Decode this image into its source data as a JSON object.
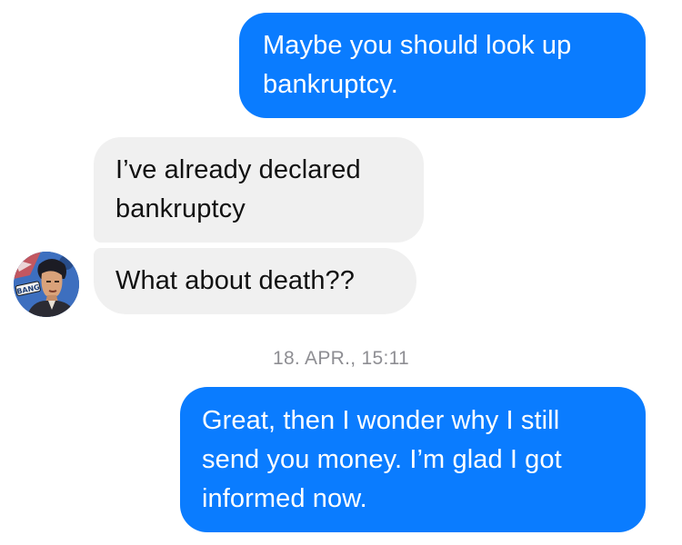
{
  "conversation": {
    "messages": [
      {
        "direction": "outgoing",
        "text": "Maybe you should look up bankruptcy."
      },
      {
        "direction": "incoming",
        "text": "I’ve already declared bankruptcy"
      },
      {
        "direction": "incoming",
        "text": "What about death??"
      },
      {
        "direction": "outgoing",
        "text": "Great, then I wonder why I still send you money. I’m glad I got informed now."
      }
    ],
    "timestamp": "18. APR., 15:11"
  },
  "contact": {
    "avatar_icon": "comic-portrait-avatar",
    "avatar_text": "BANG"
  },
  "colors": {
    "outgoing_bubble": "#0a7cff",
    "incoming_bubble": "#f0f0f0",
    "timestamp": "#8e8e93"
  }
}
